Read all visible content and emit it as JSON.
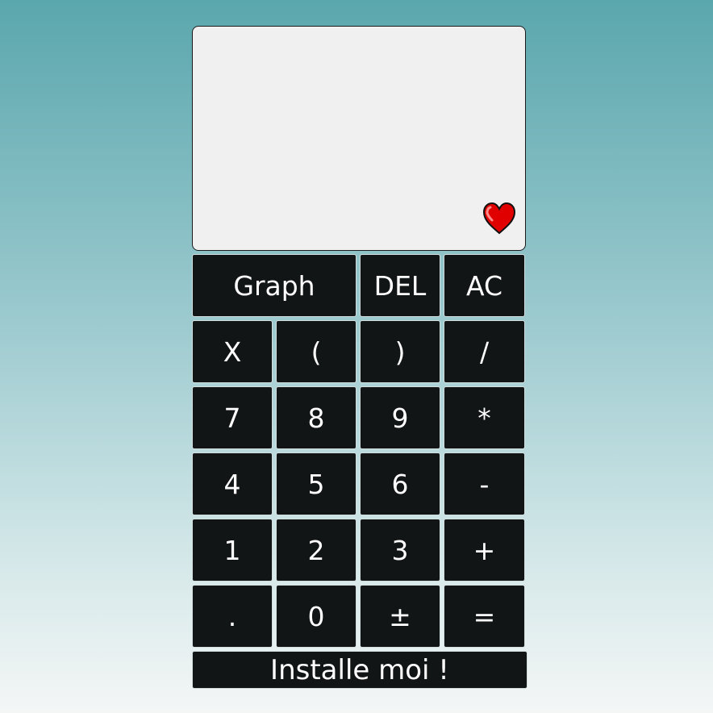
{
  "screen": {
    "output": "",
    "favorite_icon": "heart-icon"
  },
  "keys": {
    "graph": "Graph",
    "del": "DEL",
    "ac": "AC",
    "x": "X",
    "open_paren": "(",
    "close_paren": ")",
    "divide": "/",
    "seven": "7",
    "eight": "8",
    "nine": "9",
    "multiply": "*",
    "four": "4",
    "five": "5",
    "six": "6",
    "minus": "-",
    "one": "1",
    "two": "2",
    "three": "3",
    "plus": "+",
    "decimal": ".",
    "zero": "0",
    "plus_minus": "±",
    "equals": "="
  },
  "install": {
    "label": "Installe moi !"
  },
  "colors": {
    "key_background": "#121516",
    "key_text": "#ffffff",
    "screen_background": "#f0f0f0",
    "heart": "#e00000"
  }
}
